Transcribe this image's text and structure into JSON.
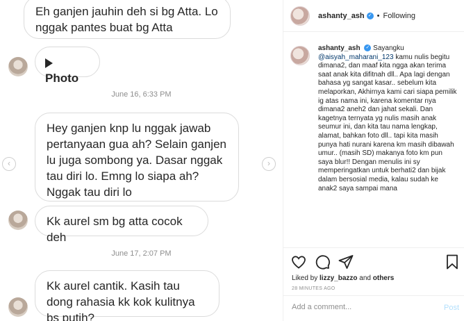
{
  "dm": {
    "msg1": "Eh ganjen jauhin deh si bg Atta. Lo nggak pantes buat bg Atta",
    "photo_label": "Photo",
    "stamp1": "June 16, 6:33 PM",
    "msg2": "Hey ganjen knp lu nggak jawab pertanyaan gua ah? Selain ganjen lu juga sombong ya. Dasar nggak tau diri lo. Emng lo siapa ah? Nggak tau diri lo",
    "msg3": "Kk aurel sm bg atta cocok deh",
    "stamp2": "June 17, 2:07 PM",
    "msg4": "Kk aurel cantik. Kasih tau dong rahasia kk kok kulitnya bs putih?"
  },
  "header": {
    "username": "ashanty_ash",
    "separator": "•",
    "follow_label": "Following"
  },
  "caption": {
    "username": "ashanty_ash",
    "lead": "Sayangku",
    "mention": "@aisyah_maharani_123",
    "text": "kamu nulis begitu dimana2, dan maaf kita ngga akan terima saat anak kita difitnah dll.. Apa lagi dengan bahasa yg sangat kasar.. sebelum kita melaporkan, Akhirnya kami cari siapa pemilik ig atas nama ini, karena komentar nya dimana2 aneh2 dan jahat sekali. Dan kagetnya ternyata yg nulis masih anak seumur ini, dan kita tau nama lengkap, alamat, bahkan foto dll.. tapi kita masih punya hati nurani karena km masih dibawah umur.. (masih SD) makanya foto km pun saya blur!! Dengan menulis ini sy memperingatkan untuk berhati2 dan bijak dalam bersosial media, kalau sudah ke anak2 saya sampai mana"
  },
  "likes": {
    "prefix": "Liked by",
    "user": "lizzy_bazzo",
    "middle": "and",
    "others": "others"
  },
  "time_ago": "28 MINUTES AGO",
  "comment_box": {
    "placeholder": "Add a comment...",
    "post_label": "Post"
  },
  "icons": [
    "heart-icon",
    "comment-icon",
    "share-icon",
    "bookmark-icon",
    "chevron-left-icon",
    "chevron-right-icon",
    "verified-icon",
    "play-icon"
  ],
  "colors": {
    "verified": "#3897f0",
    "mention": "#00376b",
    "post": "#b2dffc",
    "meta": "#8e8e8e"
  }
}
